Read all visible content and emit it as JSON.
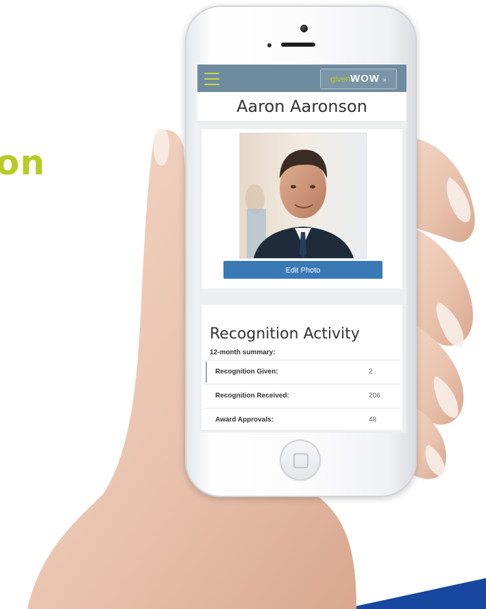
{
  "headline": {
    "text": "on"
  },
  "app": {
    "brand": {
      "prefix": "given",
      "name": "WOW",
      "suffix": "»"
    },
    "profile_name": "Aaron Aaronson",
    "edit_photo_label": "Edit Photo"
  },
  "activity": {
    "title": "Recognition Activity",
    "subtitle": "12-month summary:",
    "rows": [
      {
        "label": "Recognition Given:",
        "value": "2"
      },
      {
        "label": "Recognition Received:",
        "value": "206"
      },
      {
        "label": "Award Approvals:",
        "value": "48"
      }
    ]
  },
  "colors": {
    "headline": "#b6cc22",
    "header_bar": "#6f8ba0",
    "button": "#3979b6",
    "accent_band": "#17479e"
  },
  "icons": {
    "menu": "hamburger-menu-icon",
    "home": "home-button-icon",
    "camera": "camera-icon"
  }
}
